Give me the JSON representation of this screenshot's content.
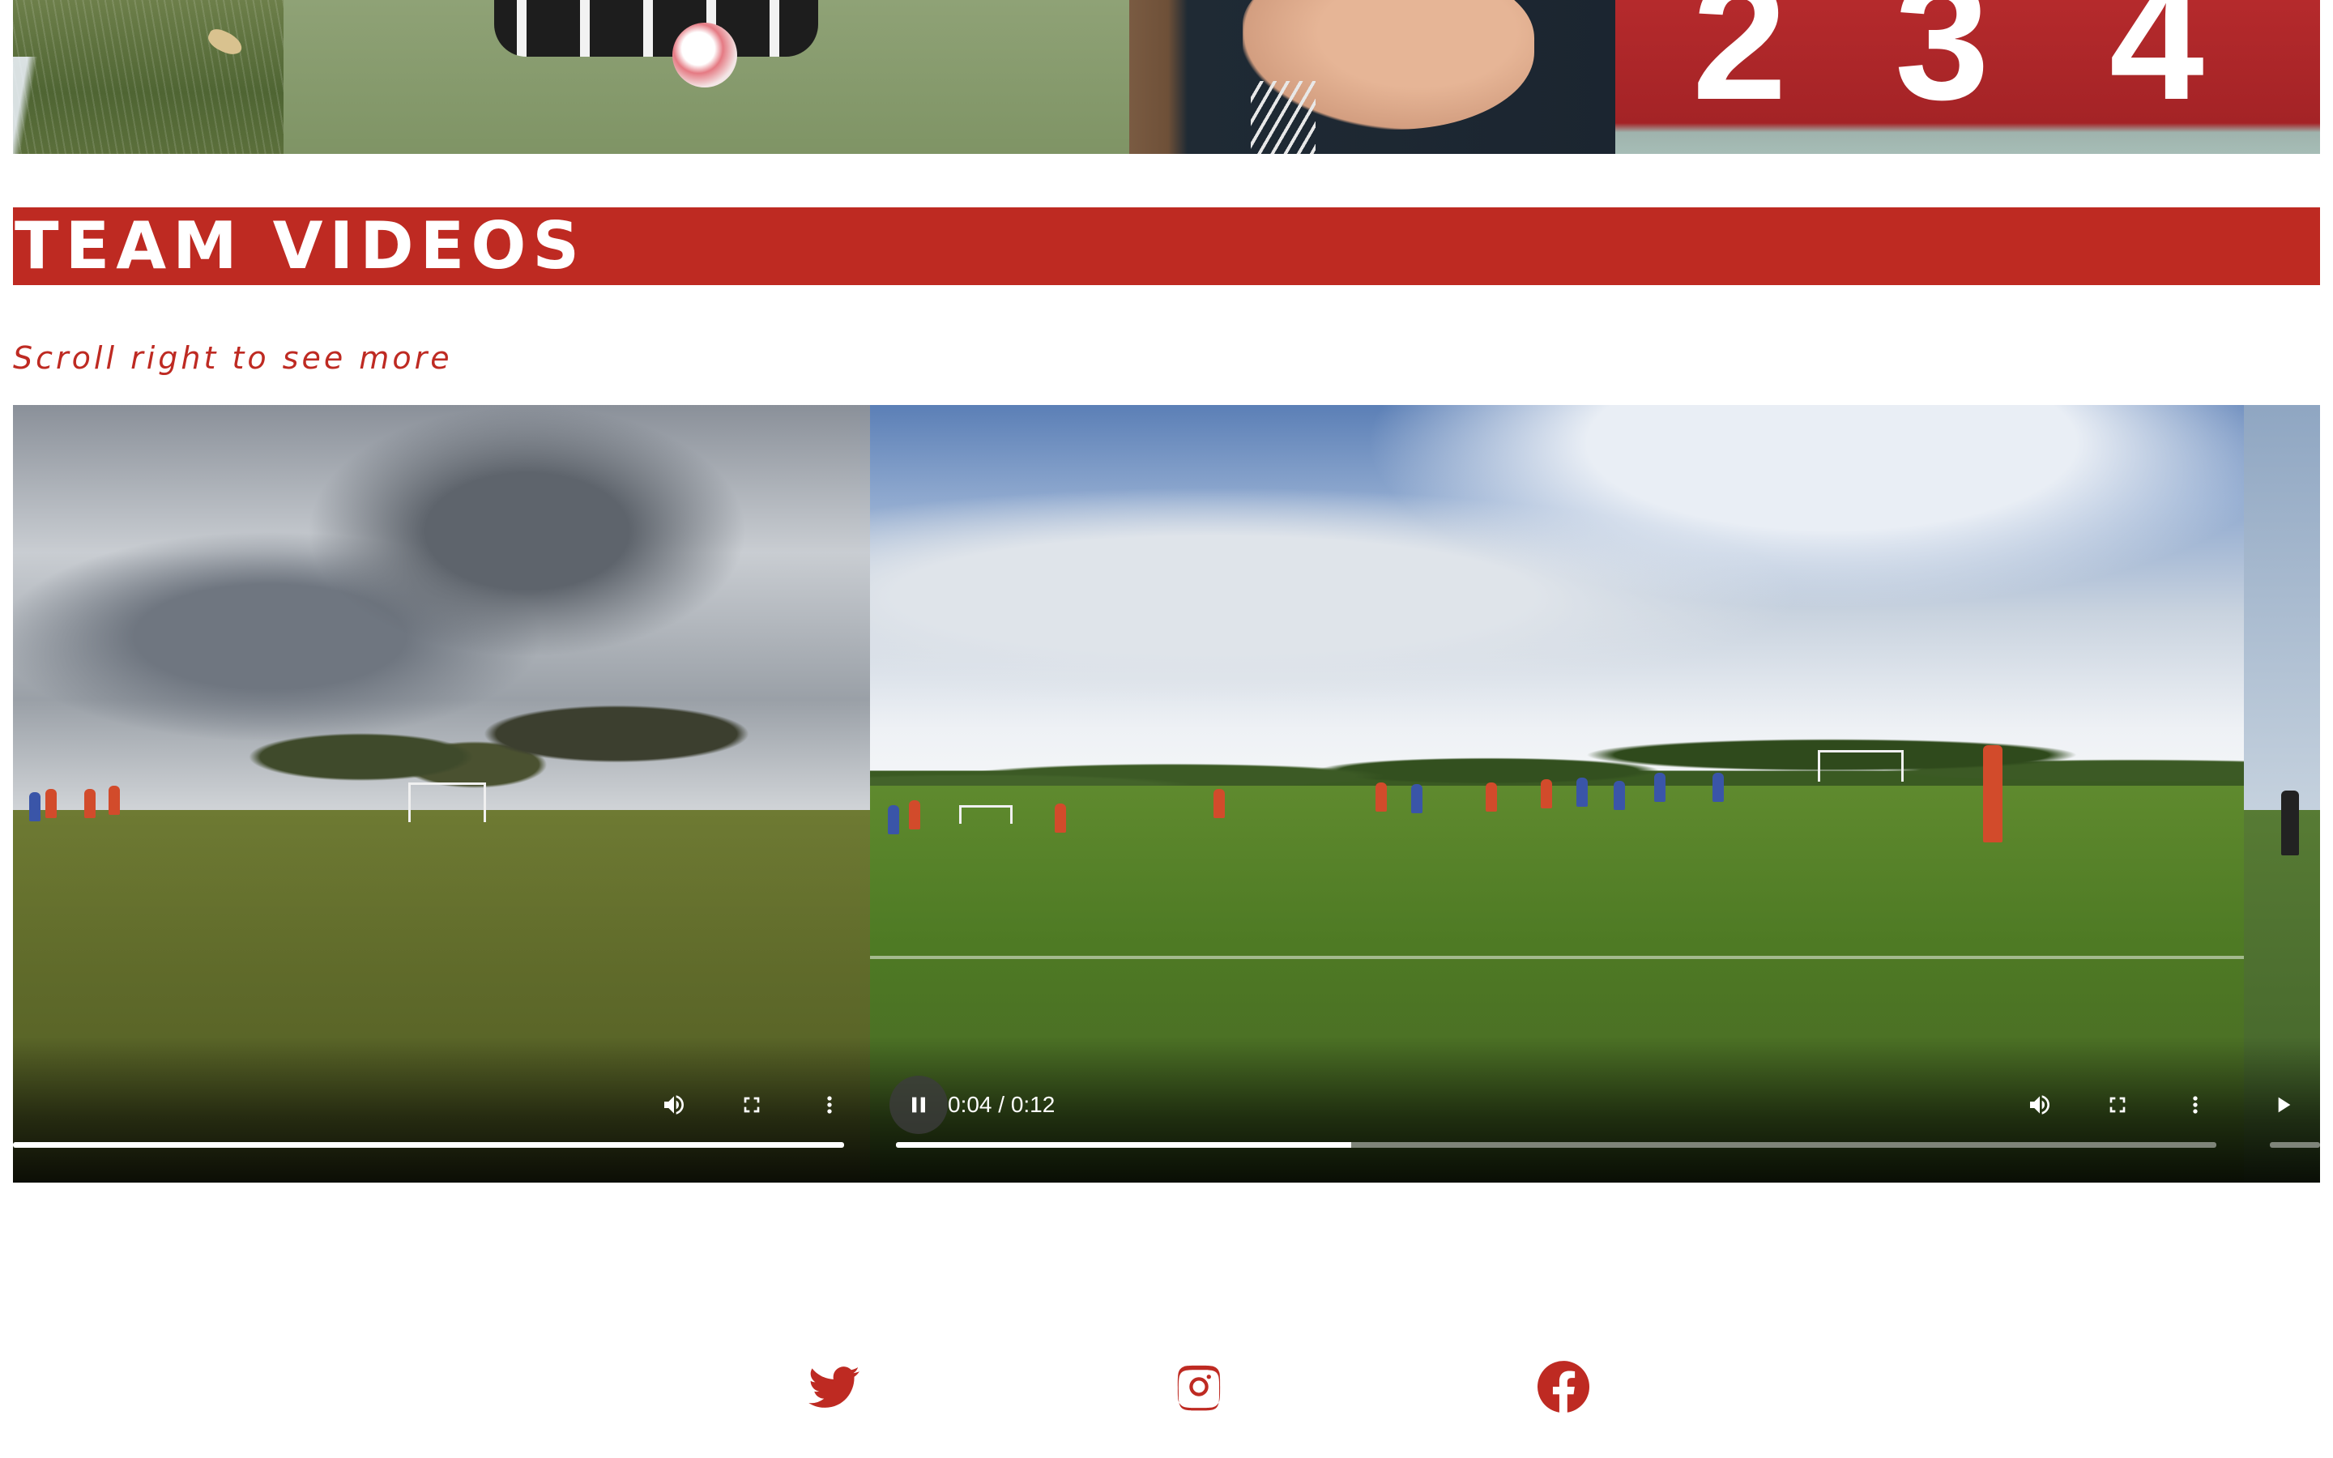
{
  "photos": {
    "jersey_numbers": [
      "2",
      "3",
      "4"
    ]
  },
  "section": {
    "title": "TEAM VIDEOS",
    "subtitle": "Scroll right to see more"
  },
  "videos": [
    {
      "progress": 1.0
    },
    {
      "time_display": "0:04 / 0:12",
      "progress": 0.345
    },
    {
      "progress": 0.0
    }
  ],
  "social": {
    "icons": [
      "twitter-icon",
      "instagram-icon",
      "facebook-icon"
    ]
  },
  "colors": {
    "brand_red": "#be2a22",
    "text_white": "#ffffff",
    "video_bg": "#000000"
  }
}
